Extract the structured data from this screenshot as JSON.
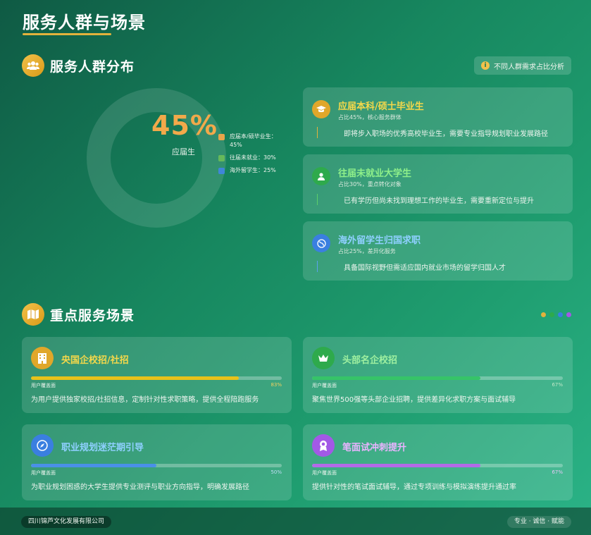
{
  "page": {
    "title": "服务人群与场景"
  },
  "distribution": {
    "title": "服务人群分布",
    "hint": "不同人群需求占比分析",
    "center_value": "45%",
    "center_label": "应届生",
    "legend": [
      {
        "label": "应届本/硕毕业生：45%",
        "color": "#e8a54a"
      },
      {
        "label": "往届未就业：30%",
        "color": "#66b85a"
      },
      {
        "label": "海外留学生：25%",
        "color": "#3f86d8"
      }
    ],
    "chart_data": {
      "type": "pie",
      "categories": [
        "应届本/硕毕业生",
        "往届未就业",
        "海外留学生"
      ],
      "values": [
        45,
        30,
        25
      ]
    }
  },
  "groups": [
    {
      "title": "应届本科/硕士毕业生",
      "meta": "占比45%，核心服务群体",
      "desc": "即将步入职场的优秀高校毕业生，需要专业指导规划职业发展路径",
      "title_color": "#f5d84a",
      "icon_color": "#e0a72a",
      "bar_color": "#e3b23c",
      "icon": "graduation-cap-icon"
    },
    {
      "title": "往届未就业大学生",
      "meta": "占比30%，重点转化对象",
      "desc": "已有学历但尚未找到理想工作的毕业生，需要重新定位与提升",
      "title_color": "#8ff08a",
      "icon_color": "#2eaa4c",
      "bar_color": "#5ccf6a",
      "icon": "user-icon"
    },
    {
      "title": "海外留学生归国求职",
      "meta": "占比25%，差异化服务",
      "desc": "具备国际视野但需适应国内就业市场的留学归国人才",
      "title_color": "#8fd0ff",
      "icon_color": "#3a7fe0",
      "bar_color": "#5aa2ef",
      "icon": "globe-icon"
    }
  ],
  "scenes": {
    "title": "重点服务场景",
    "dot_colors": [
      "#e3b23c",
      "#2eaa4c",
      "#3a7fe0",
      "#a259e6"
    ],
    "items": [
      {
        "title": "央国企校招/社招",
        "progress_label": "用户覆盖面",
        "progress": 83,
        "progress_text": "83%",
        "desc": "为用户提供独家校招/社招信息，定制针对性求职策略，提供全程陪跑服务",
        "title_color": "#f5d84a",
        "fill": "#e8c21a",
        "pct_color": "#f0d060",
        "icon_color": "#e0a72a",
        "icon": "building-icon"
      },
      {
        "title": "头部名企校招",
        "progress_label": "用户覆盖面",
        "progress": 67,
        "progress_text": "67%",
        "desc": "聚焦世界500强等头部企业招聘，提供差异化求职方案与面试辅导",
        "title_color": "#9ff0a0",
        "fill": "#36c468",
        "pct_color": "#bfe8c8",
        "icon_color": "#2eaa4c",
        "icon": "crown-icon"
      },
      {
        "title": "职业规划迷茫期引导",
        "progress_label": "用户覆盖面",
        "progress": 50,
        "progress_text": "50%",
        "desc": "为职业规划困惑的大学生提供专业测评与职业方向指导，明确发展路径",
        "title_color": "#8fd0ff",
        "fill": "#4a90e8",
        "pct_color": "#bfdcf5",
        "icon_color": "#3a7fe0",
        "icon": "compass-icon"
      },
      {
        "title": "笔面试冲刺提升",
        "progress_label": "用户覆盖面",
        "progress": 67,
        "progress_text": "67%",
        "desc": "提供针对性的笔试面试辅导，通过专项训练与模拟演练提升通过率",
        "title_color": "#e9b4ff",
        "fill": "#b36ae8",
        "pct_color": "#e3c7f5",
        "icon_color": "#a259e6",
        "icon": "award-icon"
      }
    ]
  },
  "footer": {
    "company": "四川锦芦文化发展有限公司",
    "slogan": "专业 · 诚信 · 赋能"
  }
}
